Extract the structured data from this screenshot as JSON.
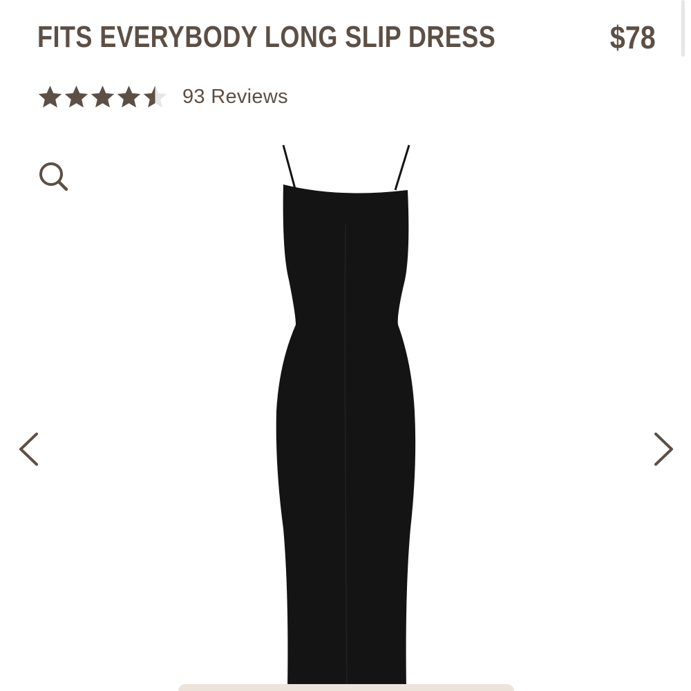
{
  "product": {
    "title": "FITS EVERYBODY LONG SLIP DRESS",
    "price": "$78"
  },
  "rating": {
    "value": 4.5,
    "max": 5,
    "reviews_label": "93 Reviews"
  },
  "gallery": {
    "zoom_icon": "search-icon",
    "prev_icon": "chevron-left-icon",
    "next_icon": "chevron-right-icon",
    "image_subject": "product-image-dress"
  },
  "colors": {
    "text": "#5c4f45",
    "star_filled": "#5c4f45",
    "star_empty": "#e6e6e6",
    "dress": "#141414",
    "bottom_bar": "#ece4da"
  }
}
